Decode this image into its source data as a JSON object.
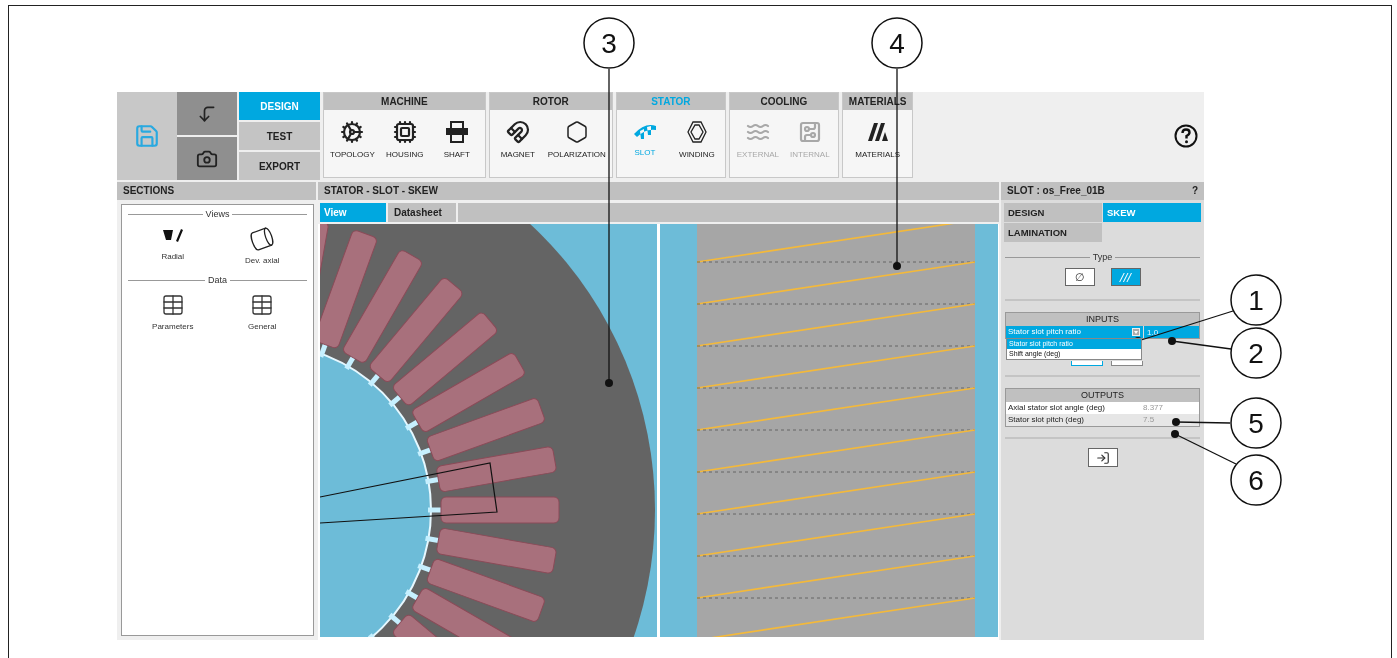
{
  "toolbar": {
    "modes": [
      {
        "label": "DESIGN",
        "selected": true
      },
      {
        "label": "TEST",
        "selected": false
      },
      {
        "label": "EXPORT",
        "selected": false
      }
    ],
    "groups": [
      {
        "title": "MACHINE",
        "selected": false,
        "items": [
          {
            "label": "TOPOLOGY",
            "kind": "topology",
            "selected": false,
            "disabled": false
          },
          {
            "label": "HOUSING",
            "kind": "housing",
            "selected": false,
            "disabled": false
          },
          {
            "label": "SHAFT",
            "kind": "shaft",
            "selected": false,
            "disabled": false
          }
        ]
      },
      {
        "title": "ROTOR",
        "selected": false,
        "items": [
          {
            "label": "MAGNET",
            "kind": "magnet",
            "selected": false,
            "disabled": false
          },
          {
            "label": "POLARIZATION",
            "kind": "polarization",
            "selected": false,
            "disabled": false
          }
        ]
      },
      {
        "title": "STATOR",
        "selected": true,
        "items": [
          {
            "label": "SLOT",
            "kind": "slot",
            "selected": true,
            "disabled": false
          },
          {
            "label": "WINDING",
            "kind": "winding",
            "selected": false,
            "disabled": false
          }
        ]
      },
      {
        "title": "COOLING",
        "selected": false,
        "items": [
          {
            "label": "EXTERNAL",
            "kind": "external",
            "selected": false,
            "disabled": true
          },
          {
            "label": "INTERNAL",
            "kind": "internal",
            "selected": false,
            "disabled": true
          }
        ]
      },
      {
        "title": "MATERIALS",
        "selected": false,
        "items": [
          {
            "label": "MATERIALS",
            "kind": "materials",
            "selected": false,
            "disabled": false
          }
        ]
      }
    ]
  },
  "sections": {
    "title": "SECTIONS",
    "groups": [
      {
        "title": "Views",
        "items": [
          {
            "label": "Radial",
            "kind": "radial"
          },
          {
            "label": "Dev. axial",
            "kind": "axial"
          }
        ]
      },
      {
        "title": "Data",
        "items": [
          {
            "label": "Parameters",
            "kind": "table"
          },
          {
            "label": "General",
            "kind": "table"
          }
        ]
      }
    ]
  },
  "view": {
    "title": "STATOR - SLOT - SKEW",
    "tabs": [
      {
        "label": "View",
        "selected": true
      },
      {
        "label": "Datasheet",
        "selected": false
      }
    ]
  },
  "slot_panel": {
    "title": "SLOT : os_Free_01B",
    "help": "?",
    "tabs": [
      {
        "label": "DESIGN",
        "selected": false
      },
      {
        "label": "SKEW",
        "selected": true
      },
      {
        "label": "LAMINATION",
        "selected": false
      }
    ],
    "type_legend": "Type",
    "type_options": [
      {
        "label": "∅",
        "selected": false
      },
      {
        "label": "///",
        "selected": true
      }
    ],
    "inputs": {
      "title": "INPUTS",
      "rows": [
        {
          "label": "Stator slot pitch ratio",
          "value": "1.0",
          "selected": true
        }
      ],
      "dropdown": {
        "expanded": true,
        "options": [
          {
            "label": "Stator slot pitch ratio",
            "selected": true
          },
          {
            "label": "Shift angle (deg)",
            "selected": false
          }
        ]
      }
    },
    "outputs": {
      "title": "OUTPUTS",
      "rows": [
        {
          "label": "Axial stator slot angle (deg)",
          "value": "8.377"
        },
        {
          "label": "Stator slot pitch (deg)",
          "value": "7.5"
        }
      ]
    }
  },
  "callouts": [
    {
      "number": "3"
    },
    {
      "number": "4"
    },
    {
      "number": "1"
    },
    {
      "number": "2"
    },
    {
      "number": "5"
    },
    {
      "number": "6"
    }
  ]
}
